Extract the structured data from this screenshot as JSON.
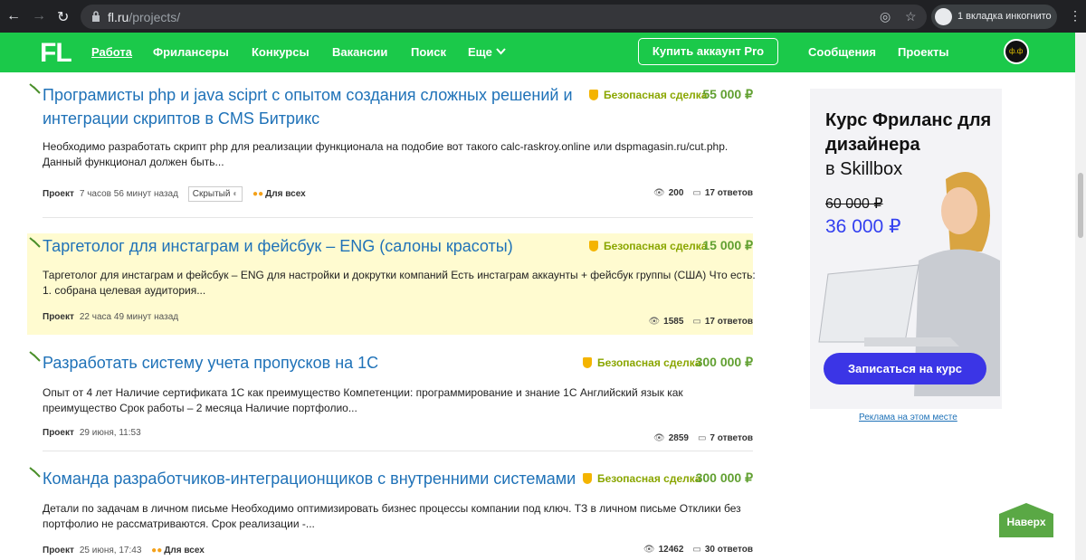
{
  "browser": {
    "back": "←",
    "forward": "→",
    "reload": "↻",
    "url_host": "fl.ru",
    "url_path": "/projects/",
    "incognito_label": "1 вкладка инкогнито",
    "menu": "⋮"
  },
  "header": {
    "logo": "FL",
    "nav": [
      "Работа",
      "Фрилансеры",
      "Конкурсы",
      "Вакансии",
      "Поиск",
      "Еще"
    ],
    "pro_button": "Купить аккаунт Pro",
    "messages": "Сообщения",
    "projects": "Проекты",
    "avatar_text": "ф.ф"
  },
  "projects": [
    {
      "title": "Програмисты php и java sciprt с опытом создания сложных решений и интеграции скриптов в CMS Битрикс",
      "safe_deal": "Безопасная сделка",
      "price": "55 000 ₽",
      "description": "Необходимо разработать скрипт php для реализации функционала на подобие вот такого calc-raskroy.online  или dspmagasin.ru/cut.php. Данный функционал должен быть...",
      "type": "Проект",
      "time": "7 часов 56 минут назад",
      "hidden_badge": "Скрытый",
      "for_all": "Для всех",
      "views": "200",
      "answers": "17 ответов"
    },
    {
      "title": "Таргетолог для инстаграм и фейсбук – ENG (салоны красоты)",
      "safe_deal": "Безопасная сделка",
      "price": "15 000 ₽",
      "description": "Таргетолог для инстаграм и фейсбук – ENG для настройки и докрутки компаний Есть инстаграм аккаунты + фейсбук группы (США) Что есть: 1. собрана целевая аудитория...",
      "type": "Проект",
      "time": "22 часа 49 минут назад",
      "views": "1585",
      "answers": "17 ответов"
    },
    {
      "title": "Разработать систему учета пропусков на 1С",
      "safe_deal": "Безопасная сделка",
      "price": "300 000 ₽",
      "description": "Опыт от 4 лет Наличие сертификата 1С как преимущество Компетенции: программирование и знание 1С Английский язык как преимущество Срок работы – 2 месяца Наличие портфолио...",
      "type": "Проект",
      "time": "29 июня, 11:53",
      "views": "2859",
      "answers": "7 ответов"
    },
    {
      "title": "Команда разработчиков-интеграционщиков с внутренними системами",
      "safe_deal": "Безопасная сделка",
      "price": "300 000 ₽",
      "description": "Детали по задачам в личном письме  Необходимо оптимизировать бизнес процессы компании под ключ. ТЗ в личном письме Отклики без портфолио не рассматриваются.  Срок реализации -...",
      "type": "Проект",
      "time": "25 июня, 17:43",
      "for_all": "Для всех",
      "views": "12462",
      "answers": "30 ответов"
    }
  ],
  "ad": {
    "headline": "Курс Фриланс для дизайнера",
    "brand": "в Skillbox",
    "old_price": "60 000 ₽",
    "new_price": "36 000 ₽",
    "cta": "Записаться на курс",
    "ad_link": "Реклама на этом месте"
  },
  "scroll_top": "Наверх",
  "colors": {
    "header_green": "#1bc94a",
    "link_blue": "#1f72b8",
    "price_green": "#61a031",
    "highlight": "#fffbd0",
    "cta_blue": "#3b35e6"
  }
}
